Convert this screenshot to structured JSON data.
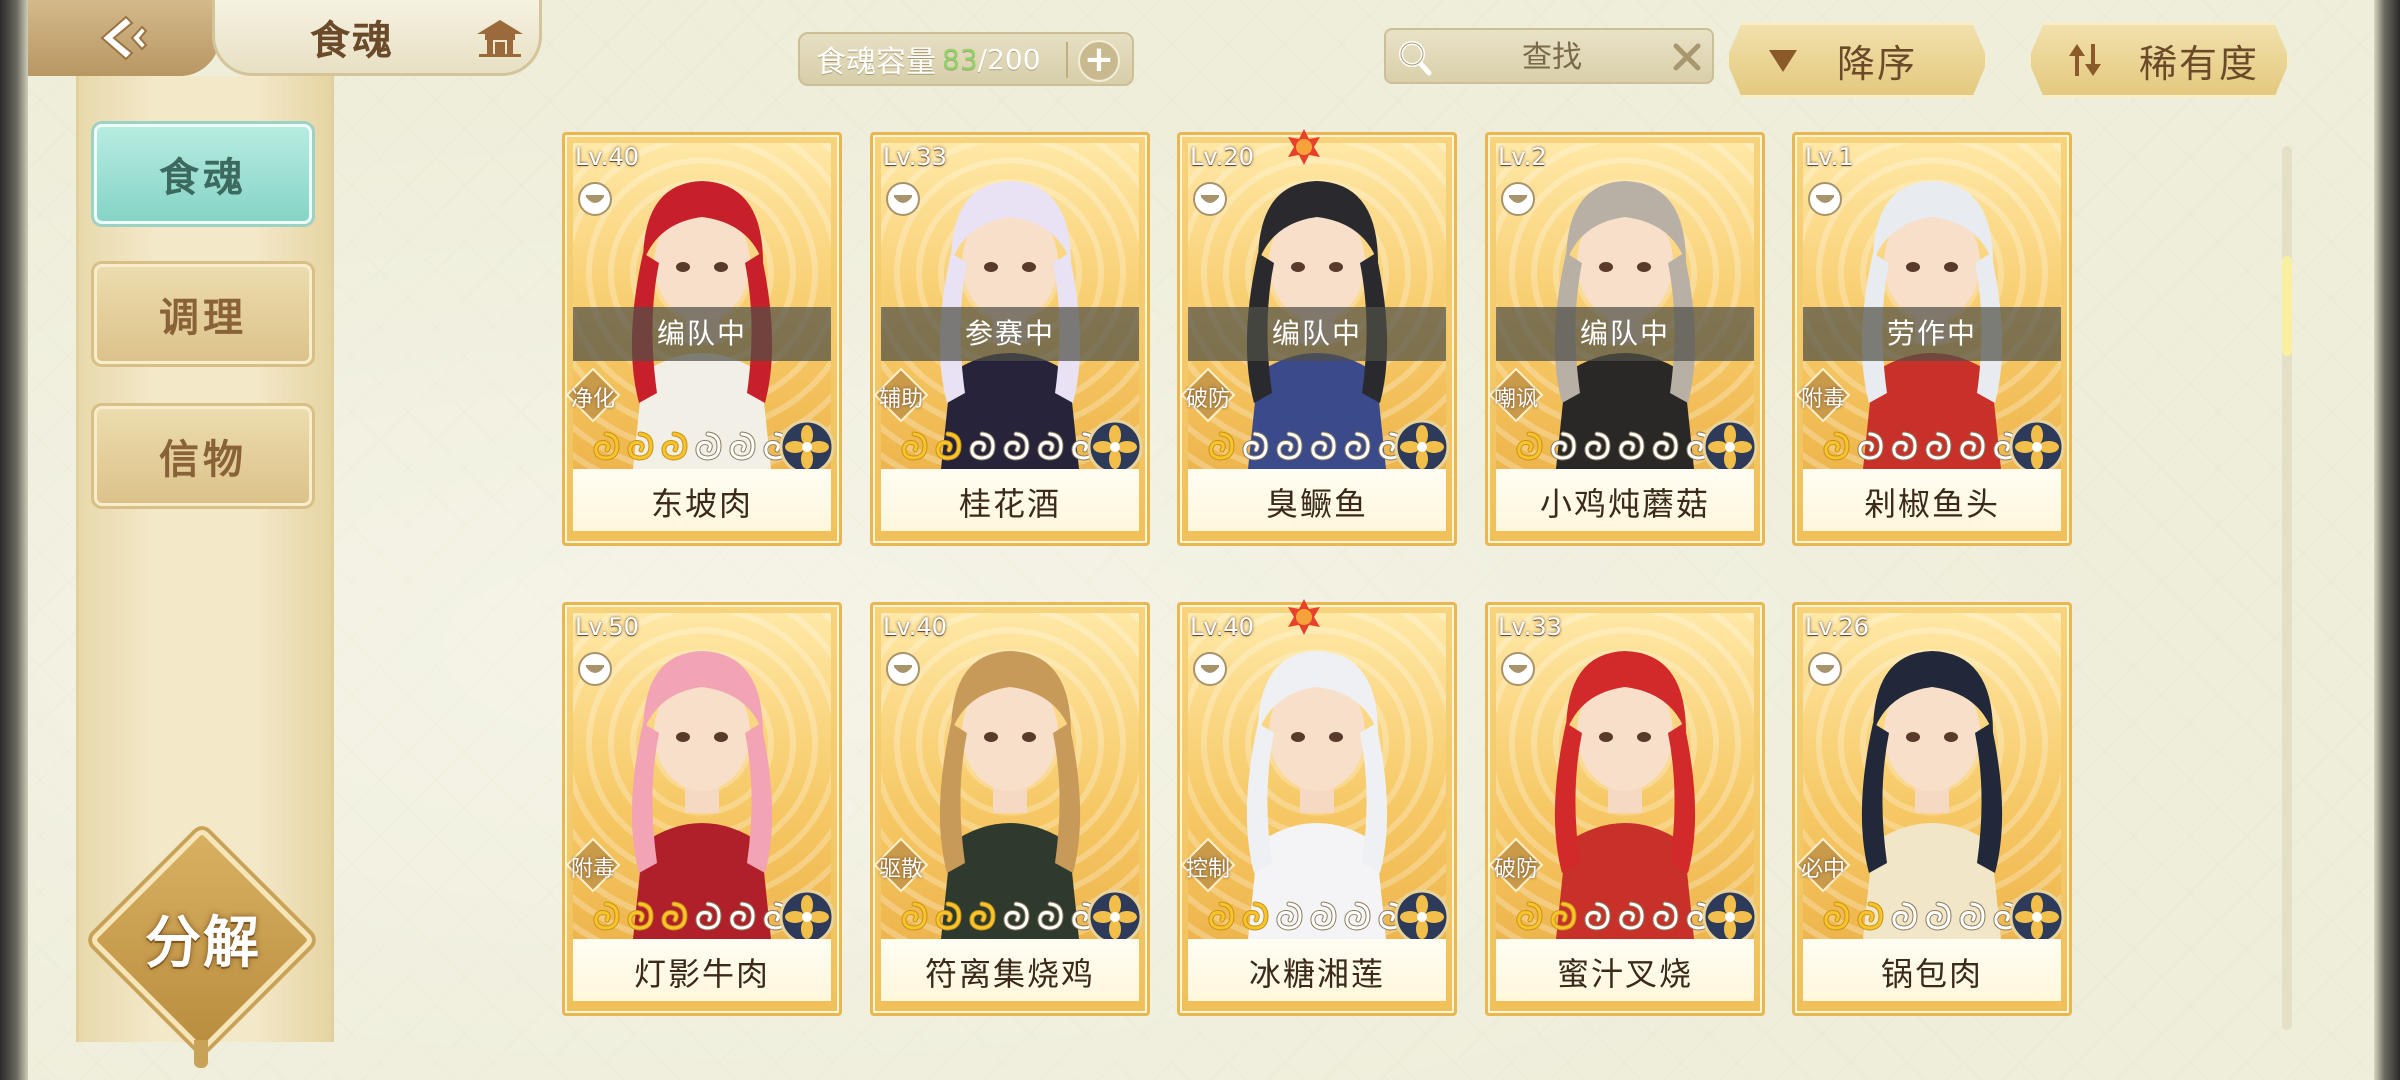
{
  "header": {
    "title": "食魂",
    "capacity_label": "食魂容量",
    "capacity_current": "83",
    "capacity_max": "/200",
    "capacity_add": "+"
  },
  "search": {
    "placeholder": "查找"
  },
  "sort": {
    "order_label": "降序",
    "rarity_label": "稀有度"
  },
  "sidebar": {
    "items": [
      {
        "label": "食魂",
        "active": true
      },
      {
        "label": "调理",
        "active": false
      },
      {
        "label": "信物",
        "active": false
      }
    ],
    "decompose_label": "分解"
  },
  "colors": {
    "accent_teal": "#85d4c6",
    "gold": "#f0c05a",
    "capacity_current": "#8fd36a",
    "status_overlay": "#50504a"
  },
  "cards": [
    {
      "level": "Lv.40",
      "status": "编队中",
      "role": "净化",
      "stars_lit": 3,
      "name": "东坡肉",
      "full": false,
      "hair": "#c8202a",
      "outfit": "#f2efe6"
    },
    {
      "level": "Lv.33",
      "status": "参赛中",
      "role": "辅助",
      "stars_lit": 2,
      "name": "桂花酒",
      "full": false,
      "hair": "#e8e2f4",
      "outfit": "#26233a"
    },
    {
      "level": "Lv.20",
      "status": "编队中",
      "role": "破防",
      "stars_lit": 1,
      "name": "臭鳜鱼",
      "full": true,
      "hair": "#2a2a2e",
      "outfit": "#3a4a8a"
    },
    {
      "level": "Lv.2",
      "status": "编队中",
      "role": "嘲讽",
      "stars_lit": 1,
      "name": "小鸡炖蘑菇",
      "full": false,
      "hair": "#b8b0a4",
      "outfit": "#2a2826"
    },
    {
      "level": "Lv.1",
      "status": "劳作中",
      "role": "附毒",
      "stars_lit": 1,
      "name": "剁椒鱼头",
      "full": false,
      "hair": "#e8ecf0",
      "outfit": "#c8302a"
    },
    {
      "level": "Lv.50",
      "status": "",
      "role": "附毒",
      "stars_lit": 3,
      "name": "灯影牛肉",
      "full": false,
      "hair": "#f2a4b4",
      "outfit": "#b0202a"
    },
    {
      "level": "Lv.40",
      "status": "",
      "role": "驱散",
      "stars_lit": 3,
      "name": "符离集烧鸡",
      "full": false,
      "hair": "#c89a5a",
      "outfit": "#2e3a2e"
    },
    {
      "level": "Lv.40",
      "status": "",
      "role": "控制",
      "stars_lit": 2,
      "name": "冰糖湘莲",
      "full": true,
      "hair": "#eef0f4",
      "outfit": "#f4f4f6"
    },
    {
      "level": "Lv.33",
      "status": "",
      "role": "破防",
      "stars_lit": 2,
      "name": "蜜汁叉烧",
      "full": false,
      "hair": "#d22a2a",
      "outfit": "#c8302a"
    },
    {
      "level": "Lv.26",
      "status": "",
      "role": "必中",
      "stars_lit": 2,
      "name": "锅包肉",
      "full": false,
      "hair": "#20283a",
      "outfit": "#f2e6c8"
    }
  ]
}
